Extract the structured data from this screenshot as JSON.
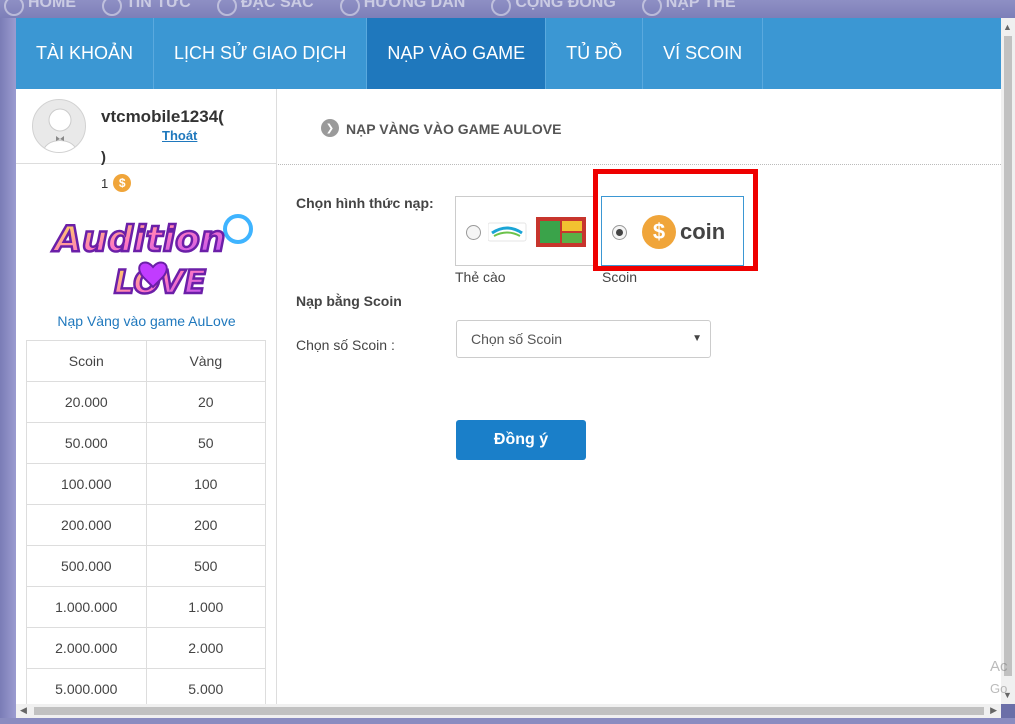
{
  "background_nav": [
    "HOME",
    "TIN TỨC",
    "ĐẶC SẮC",
    "HƯỚNG DẪN",
    "CỘNG ĐỒNG",
    "NẠP THẺ"
  ],
  "tabs": [
    {
      "label": "TÀI KHOẢN"
    },
    {
      "label": "LỊCH SỬ GIAO DỊCH"
    },
    {
      "label": "NẠP VÀO GAME",
      "active": true
    },
    {
      "label": "TỦ ĐỒ"
    },
    {
      "label": "VÍ SCOIN"
    }
  ],
  "profile": {
    "username": "vtcmobile1234(",
    "username_cont": ")",
    "logout": "Thoát",
    "balance": "1",
    "balance_icon": "scoin-coin-icon"
  },
  "game": {
    "logo_text_top": "Audition",
    "logo_text_bottom": "LOVE",
    "link": "Nạp Vàng vào game AuLove"
  },
  "rate_table": {
    "headers": [
      "Scoin",
      "Vàng"
    ],
    "rows": [
      [
        "20.000",
        "20"
      ],
      [
        "50.000",
        "50"
      ],
      [
        "100.000",
        "100"
      ],
      [
        "200.000",
        "200"
      ],
      [
        "500.000",
        "500"
      ],
      [
        "1.000.000",
        "1.000"
      ],
      [
        "2.000.000",
        "2.000"
      ],
      [
        "5.000.000",
        "5.000"
      ]
    ]
  },
  "main": {
    "title": "NẠP VÀNG VÀO GAME AULOVE",
    "method_label": "Chọn hình thức nạp:",
    "methods": [
      {
        "caption": "Thẻ cào",
        "selected": false
      },
      {
        "caption": "Scoin",
        "logo_text": "coin",
        "selected": true
      }
    ],
    "subhead": "Nạp bằng Scoin",
    "field_label": "Chọn số Scoin :",
    "select_value": "Chọn số Scoin",
    "submit_label": "Đồng ý"
  },
  "watermark": {
    "line1": "Ac",
    "line2": "Go"
  },
  "colors": {
    "tab_bar": "#3b97d3",
    "tab_active": "#1f78bd",
    "button": "#1a7fc9",
    "highlight": "#e00000"
  }
}
